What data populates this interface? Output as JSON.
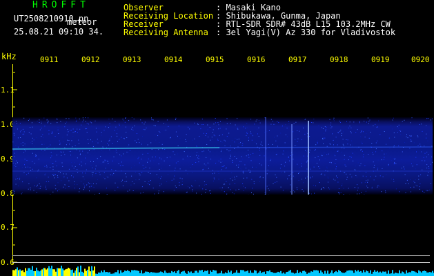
{
  "app": {
    "title": "HROFFT",
    "file_name": "UT2508210910.pn",
    "file_tag": "meteor",
    "date_time": "25.08.21 09:10    34."
  },
  "station_info": {
    "labels": [
      "Observer",
      "Receiving Location",
      "Receiver",
      "Receiving Antenna"
    ],
    "values": [
      ": Masaki Kano",
      ": Shibukawa, Gunma, Japan",
      ": RTL-SDR SDR# 43dB L15 103.2MHz CW",
      ": 3el Yagi(V) Az 330 for Vladivostok"
    ]
  },
  "plot": {
    "y_unit": "kHz",
    "y_ticks": [
      "1.1",
      "1.0",
      "0.9",
      "0.8",
      "0.7",
      "0.6"
    ],
    "y_range": [
      0.6,
      1.15
    ],
    "x_ticks": [
      "0911",
      "0912",
      "0913",
      "0914",
      "0915",
      "0916",
      "0917",
      "0918",
      "0919",
      "0920"
    ],
    "colors": {
      "text_yellow": "#ffff00",
      "text_green": "#00ff00",
      "text_white": "#ffffff",
      "signal_blue": "#1030c0",
      "echo_cyan": "#40e0ff",
      "level_cyan": "#00c8ff",
      "level_yellow": "#ffff00"
    }
  }
}
